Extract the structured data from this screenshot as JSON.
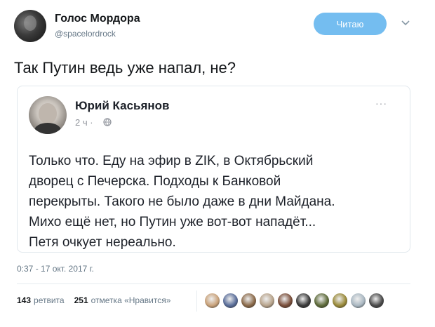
{
  "tweet": {
    "display_name": "Голос Мордора",
    "handle": "@spacelordrock",
    "follow_button": "Читаю",
    "text": "Так Путин ведь уже напал, не?",
    "timestamp": "0:37 - 17 окт. 2017 г."
  },
  "quoted_post": {
    "author": "Юрий Касьянов",
    "time": "2 ч ·",
    "more": "···",
    "lines": [
      "Только что. Еду на эфир в ZIK, в Октябрьский",
      "дворец с Печерска. Подходы к Банковой",
      "перекрыты. Такого не было даже в дни Майдана.",
      "Михо ещё нет, но Путин уже вот-вот нападёт...",
      "Петя очкует нереально."
    ]
  },
  "stats": {
    "retweets_count": "143",
    "retweets_label": "ретвита",
    "likes_count": "251",
    "likes_label": "отметка «Нравится»"
  },
  "likers": [
    {
      "color": "#c9a27a"
    },
    {
      "color": "#5a6e9a"
    },
    {
      "color": "#8b6a4a"
    },
    {
      "color": "#b8a48c"
    },
    {
      "color": "#7a4e3a"
    },
    {
      "color": "#3a3a3a"
    },
    {
      "color": "#5e6b3a"
    },
    {
      "color": "#9a8a3a"
    },
    {
      "color": "#aab8c2"
    },
    {
      "color": "#4a4a4a"
    }
  ],
  "colors": {
    "follow_button": "#74bdf0",
    "secondary_text": "#657786"
  }
}
